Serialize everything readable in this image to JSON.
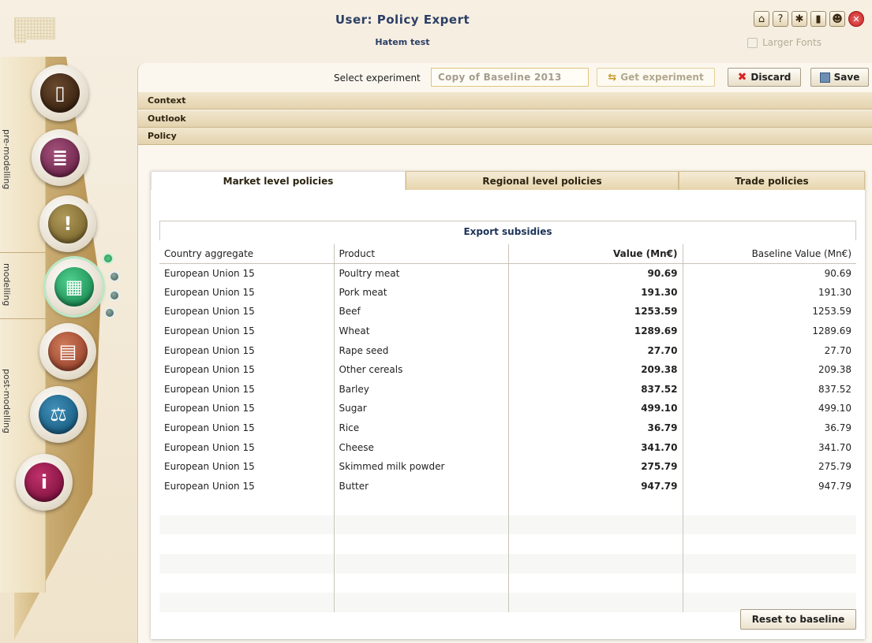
{
  "header": {
    "title": "User: Policy Expert",
    "subtitle": "Hatem test",
    "larger_fonts_label": "Larger Fonts",
    "icons": [
      "home-icon",
      "help-icon",
      "bug-icon",
      "plug-icon",
      "users-icon",
      "close-icon"
    ]
  },
  "nav": {
    "sections": [
      "pre-modelling",
      "modelling",
      "post-modelling"
    ],
    "buttons": [
      "clipboard-icon",
      "books-icon",
      "thermometer-icon",
      "calculator-icon",
      "chart-icon",
      "scales-icon",
      "info-icon"
    ]
  },
  "toolbar": {
    "select_label": "Select experiment",
    "experiment_value": "Copy of Baseline 2013",
    "get_label": "Get experiment",
    "discard_label": "Discard",
    "save_label": "Save"
  },
  "accordion": [
    "Context",
    "Outlook",
    "Policy"
  ],
  "tabs": [
    "Market level policies",
    "Regional level policies",
    "Trade policies"
  ],
  "table": {
    "title": "Export subsidies",
    "columns": [
      "Country aggregate",
      "Product",
      "Value (Mn€)",
      "Baseline Value (Mn€)"
    ],
    "rows": [
      [
        "European Union 15",
        "Poultry meat",
        "90.69",
        "90.69"
      ],
      [
        "European Union 15",
        "Pork meat",
        "191.30",
        "191.30"
      ],
      [
        "European Union 15",
        "Beef",
        "1253.59",
        "1253.59"
      ],
      [
        "European Union 15",
        "Wheat",
        "1289.69",
        "1289.69"
      ],
      [
        "European Union 15",
        "Rape seed",
        "27.70",
        "27.70"
      ],
      [
        "European Union 15",
        "Other cereals",
        "209.38",
        "209.38"
      ],
      [
        "European Union 15",
        "Barley",
        "837.52",
        "837.52"
      ],
      [
        "European Union 15",
        "Sugar",
        "499.10",
        "499.10"
      ],
      [
        "European Union 15",
        "Rice",
        "36.79",
        "36.79"
      ],
      [
        "European Union 15",
        "Cheese",
        "341.70",
        "341.70"
      ],
      [
        "European Union 15",
        "Skimmed milk powder",
        "275.79",
        "275.79"
      ],
      [
        "European Union 15",
        "Butter",
        "947.79",
        "947.79"
      ]
    ]
  },
  "reset_label": "Reset to baseline"
}
